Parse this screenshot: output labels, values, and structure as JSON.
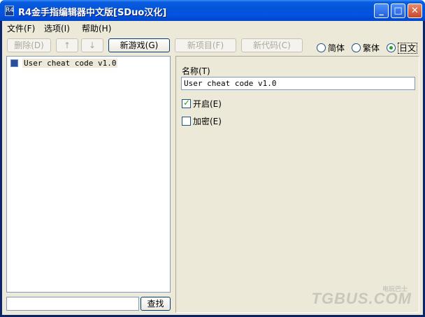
{
  "window": {
    "title": "R4金手指编辑器中文版[SDuo汉化]",
    "app_icon_text": "R4",
    "min_glyph": "_",
    "max_glyph": "□",
    "close_glyph": "✕"
  },
  "menu": [
    {
      "label": "文件(F)"
    },
    {
      "label": "选项(I)"
    },
    {
      "label": "帮助(H)"
    }
  ],
  "toolbar": {
    "delete_label": "删除(D)",
    "up_label": "↑",
    "down_label": "↓",
    "new_game_label": "新游戏(G)",
    "new_item_label": "新项目(F)",
    "new_code_label": "新代码(C)"
  },
  "language": {
    "options": [
      "简体",
      "繁体",
      "日文"
    ],
    "selected": "日文"
  },
  "tree": {
    "items": [
      {
        "label": "User cheat code v1.0"
      }
    ]
  },
  "search": {
    "value": "",
    "button_label": "查找"
  },
  "editor": {
    "name_label": "名称(T)",
    "name_value": "User cheat code v1.0",
    "enabled_label": "开启(E)",
    "enabled_checked": true,
    "encrypted_label": "加密(E)",
    "encrypted_checked": false
  },
  "watermark": {
    "text": "TGBUS.COM",
    "sub": "电玩巴士"
  }
}
